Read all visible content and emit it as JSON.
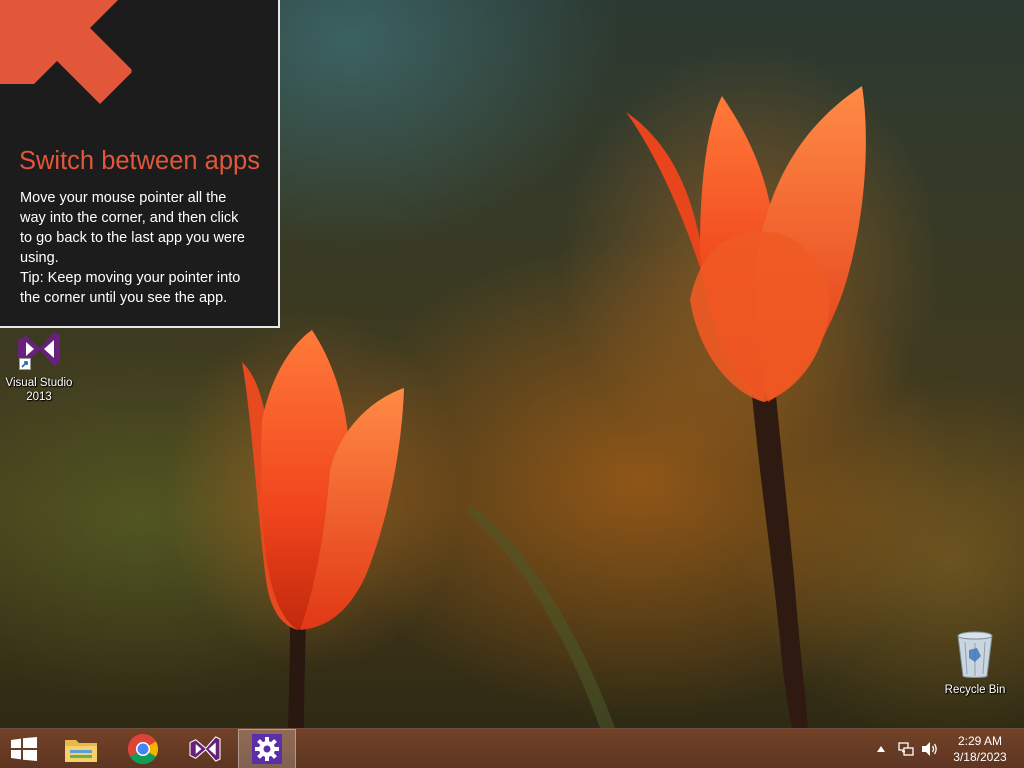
{
  "tip": {
    "title": "Switch between apps",
    "lines": [
      "Move your mouse pointer all the",
      "way into the corner, and then click",
      "to go back to the last app you were",
      "using.",
      "Tip: Keep moving your pointer into",
      "the corner until you see the app."
    ],
    "accent_color": "#e2573a"
  },
  "desktop": {
    "icons": [
      {
        "label": "Visual Studio 2013",
        "label_line1": "Visual Studio",
        "label_line2": "2013",
        "icon": "visual-studio-icon"
      },
      {
        "label": "Recycle Bin",
        "icon": "recycle-bin-icon"
      }
    ]
  },
  "taskbar": {
    "items": [
      {
        "name": "start",
        "icon": "windows-logo-icon"
      },
      {
        "name": "file-explorer",
        "icon": "folder-icon"
      },
      {
        "name": "chrome",
        "icon": "chrome-icon"
      },
      {
        "name": "visual-studio",
        "icon": "visual-studio-icon"
      },
      {
        "name": "settings",
        "icon": "gear-icon",
        "active": true
      }
    ],
    "tray": {
      "time": "2:29 AM",
      "date": "3/18/2023"
    }
  }
}
